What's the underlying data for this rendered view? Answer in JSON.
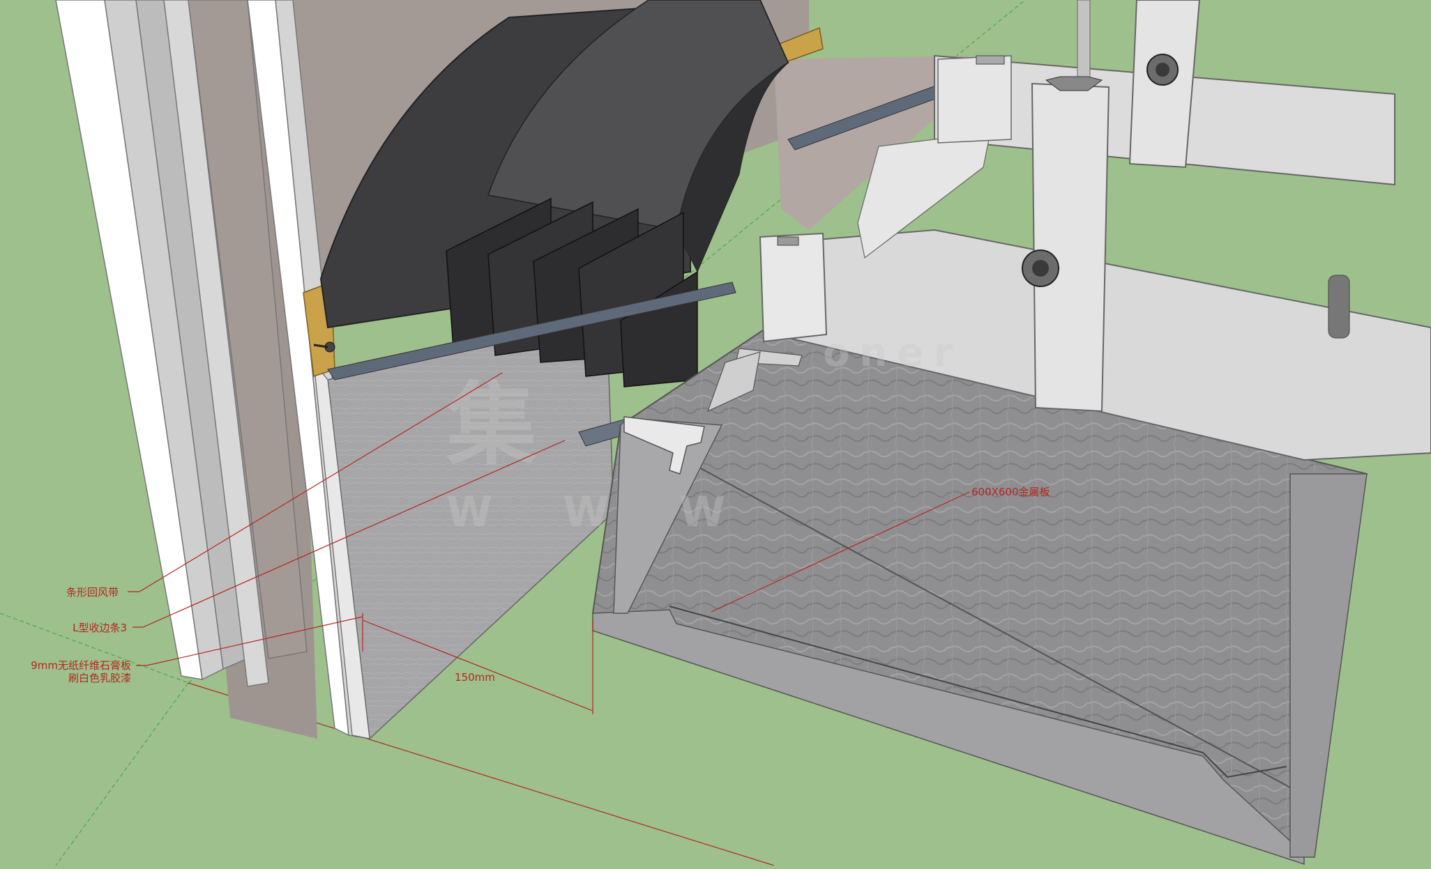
{
  "labels": {
    "return_air_strip": "条形回风带",
    "l_edge_strip": "L型收边条3",
    "gypsum_board_line1": "9mm无纸纤维石膏板",
    "gypsum_board_line2": "刷白色乳胶漆",
    "metal_panel": "600X600金属板"
  },
  "dimension": {
    "text": "150mm"
  },
  "watermark": {
    "big": "集",
    "url": "W W W",
    "small": "oner"
  },
  "colors": {
    "background": "#9dc08c",
    "annotation": "#b4271f",
    "wall": "#a39a95",
    "panel": "#8d8d8f",
    "diffuser": "#3d3d3f",
    "steel": "#d9d9d9",
    "wood": "#c9a24a"
  }
}
